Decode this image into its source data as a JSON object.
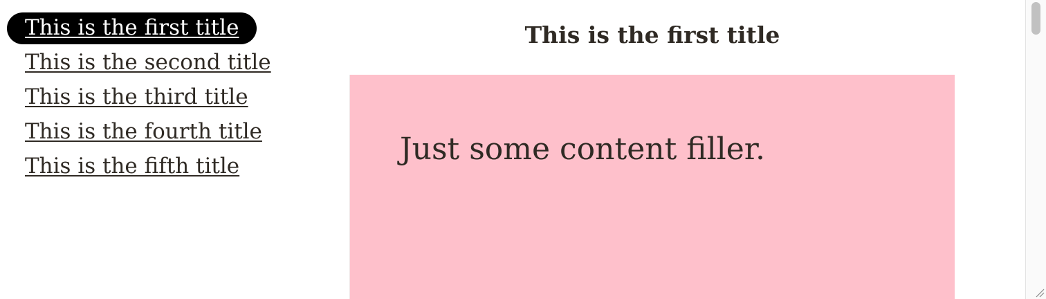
{
  "nav": {
    "items": [
      {
        "label": "This is the first title",
        "active": true
      },
      {
        "label": "This is the second title",
        "active": false
      },
      {
        "label": "This is the third title",
        "active": false
      },
      {
        "label": "This is the fourth title",
        "active": false
      },
      {
        "label": "This is the fifth title",
        "active": false
      }
    ]
  },
  "main": {
    "title": "This is the first title",
    "content": "Just some content filler."
  },
  "colors": {
    "active_pill": "#000000",
    "panel_bg": "#fec0cb",
    "text": "#2f2a24"
  },
  "icons": {
    "resize": "resize-grip-icon"
  }
}
